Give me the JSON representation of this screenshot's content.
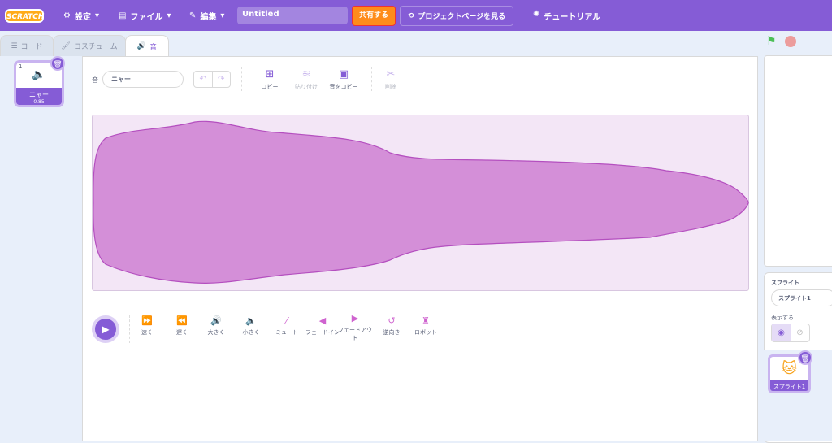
{
  "menubar": {
    "logo": "SCRATCH",
    "settings": "設定",
    "file": "ファイル",
    "edit": "編集",
    "project_title": "Untitled",
    "share": "共有する",
    "project_page": "プロジェクトページを見る",
    "tutorials": "チュートリアル"
  },
  "tabs": [
    {
      "label": "コード"
    },
    {
      "label": "コスチューム"
    },
    {
      "label": "音",
      "active": true
    }
  ],
  "sound_list": [
    {
      "index": "1",
      "name": "ニャー",
      "duration": "0.85"
    }
  ],
  "editor": {
    "sound_label": "音",
    "sound_name": "ニャー",
    "tools": [
      {
        "label": "コピー",
        "enabled": true
      },
      {
        "label": "貼り付け",
        "enabled": false
      },
      {
        "label": "音をコピー",
        "enabled": true
      },
      {
        "label": "削除",
        "enabled": false
      }
    ]
  },
  "effects": [
    {
      "label": "速く"
    },
    {
      "label": "遅く"
    },
    {
      "label": "大きく"
    },
    {
      "label": "小さく"
    },
    {
      "label": "ミュート"
    },
    {
      "label": "フェードイン"
    },
    {
      "label": "フェードアウト"
    },
    {
      "label": "逆向き"
    },
    {
      "label": "ロボット"
    }
  ],
  "sprite_panel": {
    "sprite_label": "スプライト",
    "sprite_name": "スプライト1",
    "show_label": "表示する",
    "visible": true,
    "sprites": [
      {
        "name": "スプライト1"
      }
    ]
  },
  "colors": {
    "menubar": "#855cd6",
    "share": "#ff8c1a",
    "waveform": "#cf63cf"
  }
}
